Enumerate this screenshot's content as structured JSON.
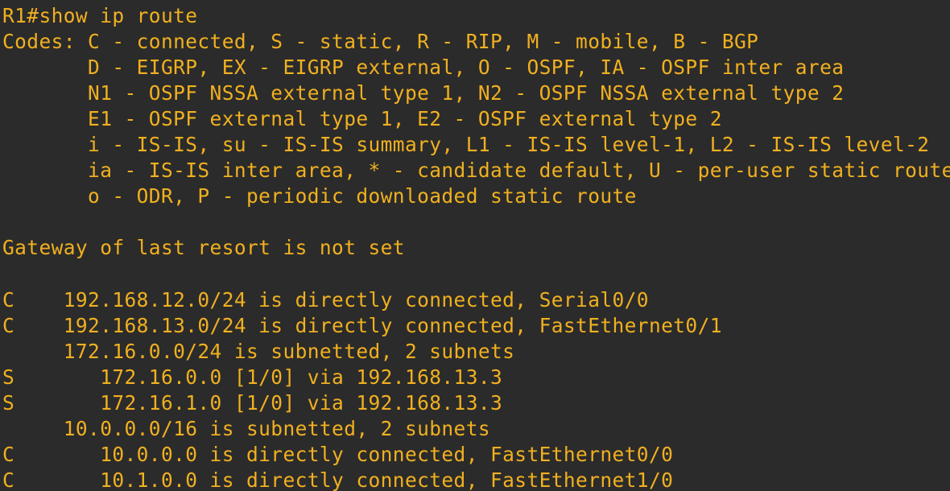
{
  "terminal": {
    "text_color": "#f0b020",
    "background_color": "#2b2b2b",
    "lines": [
      "R1#show ip route",
      "Codes: C - connected, S - static, R - RIP, M - mobile, B - BGP",
      "       D - EIGRP, EX - EIGRP external, O - OSPF, IA - OSPF inter area",
      "       N1 - OSPF NSSA external type 1, N2 - OSPF NSSA external type 2",
      "       E1 - OSPF external type 1, E2 - OSPF external type 2",
      "       i - IS-IS, su - IS-IS summary, L1 - IS-IS level-1, L2 - IS-IS level-2",
      "       ia - IS-IS inter area, * - candidate default, U - per-user static route",
      "       o - ODR, P - periodic downloaded static route",
      "",
      "Gateway of last resort is not set",
      "",
      "C    192.168.12.0/24 is directly connected, Serial0/0",
      "C    192.168.13.0/24 is directly connected, FastEthernet0/1",
      "     172.16.0.0/24 is subnetted, 2 subnets",
      "S       172.16.0.0 [1/0] via 192.168.13.3",
      "S       172.16.1.0 [1/0] via 192.168.13.3",
      "     10.0.0.0/16 is subnetted, 2 subnets",
      "C       10.0.0.0 is directly connected, FastEthernet0/0",
      "C       10.1.0.0 is directly connected, FastEthernet1/0"
    ]
  }
}
